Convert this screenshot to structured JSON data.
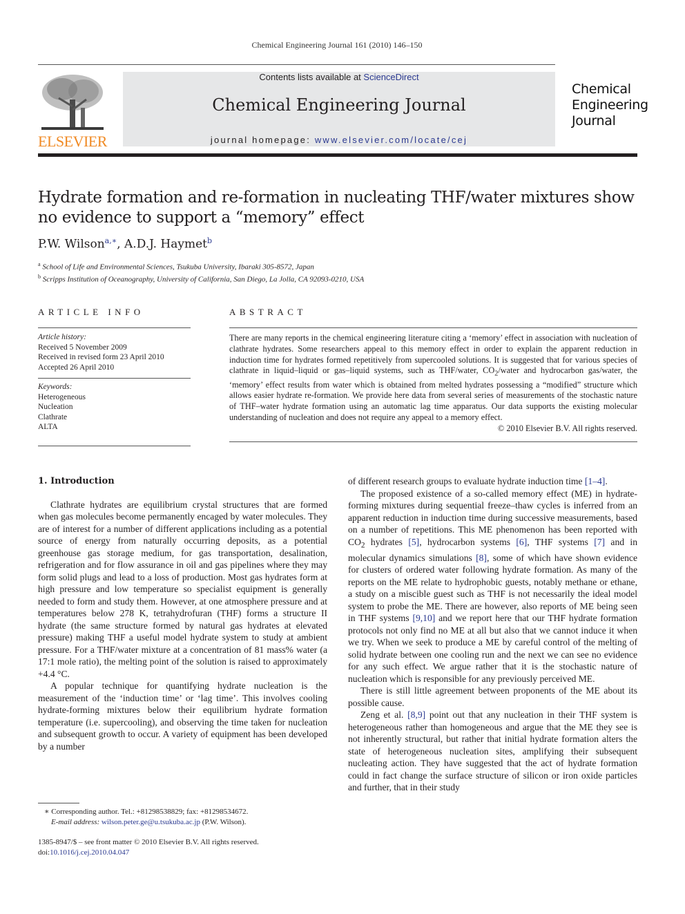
{
  "header": {
    "running_head": "Chemical Engineering Journal 161 (2010) 146–150",
    "contents_prefix": "Contents lists available at ",
    "contents_link": "ScienceDirect",
    "journal_title": "Chemical Engineering Journal",
    "homepage_prefix": "journal homepage: ",
    "homepage_link": "www.elsevier.com/locate/cej",
    "publisher_logo_text": "ELSEVIER",
    "cover_title_lines": [
      "Chemical",
      "Engineering",
      "Journal"
    ],
    "publisher_color": "#f08a24",
    "link_color": "#2b3990"
  },
  "article": {
    "title": "Hydrate formation and re-formation in nucleating THF/water mixtures show no evidence to support a “memory” effect",
    "authors": [
      {
        "name": "P.W. Wilson",
        "marks": "a,∗"
      },
      {
        "name": "A.D.J. Haymet",
        "marks": "b"
      }
    ],
    "author_separator": ", ",
    "affiliations": [
      {
        "mark": "a",
        "text": "School of Life and Environmental Sciences, Tsukuba University, Ibaraki 305-8572, Japan"
      },
      {
        "mark": "b",
        "text": "Scripps Institution of Oceanography, University of California, San Diego, La Jolla, CA 92093-0210, USA"
      }
    ]
  },
  "article_info": {
    "heading": "ARTICLE INFO",
    "history_label": "Article history:",
    "history": [
      "Received 5 November 2009",
      "Received in revised form 23 April 2010",
      "Accepted 26 April 2010"
    ],
    "keywords_label": "Keywords:",
    "keywords": [
      "Heterogeneous",
      "Nucleation",
      "Clathrate",
      "ALTA"
    ]
  },
  "abstract": {
    "heading": "ABSTRACT",
    "text_part1": "There are many reports in the chemical engineering literature citing a ‘memory’ effect in association with nucleation of clathrate hydrates. Some researchers appeal to this memory effect in order to explain the apparent reduction in induction time for hydrates formed repetitively from supercooled solutions. It is suggested that for various species of clathrate in liquid–liquid or gas–liquid systems, such as THF/water, CO",
    "text_sub": "2",
    "text_part2": "/water and hydrocarbon gas/water, the ‘memory’ effect results from water which is obtained from melted hydrates possessing a “modified” structure which allows easier hydrate re-formation. We provide here data from several series of measurements of the stochastic nature of THF–water hydrate formation using an automatic lag time apparatus. Our data supports the existing molecular understanding of nucleation and does not require any appeal to a memory effect.",
    "copyright": "© 2010 Elsevier B.V. All rights reserved."
  },
  "body": {
    "section_heading": "1.  Introduction",
    "left_paragraphs": [
      "Clathrate hydrates are equilibrium crystal structures that are formed when gas molecules become permanently encaged by water molecules. They are of interest for a number of different applications including as a potential source of energy from naturally occurring deposits, as a potential greenhouse gas storage medium, for gas transportation, desalination, refrigeration and for flow assurance in oil and gas pipelines where they may form solid plugs and lead to a loss of production. Most gas hydrates form at high pressure and low temperature so specialist equipment is generally needed to form and study them. However, at one atmosphere pressure and at temperatures below 278 K, tetrahydrofuran (THF) forms a structure II hydrate (the same structure formed by natural gas hydrates at elevated pressure) making THF a useful model hydrate system to study at ambient pressure. For a THF/water mixture at a concentration of 81 mass% water (a 17:1 mole ratio), the melting point of the solution is raised to approximately +4.4 °C.",
      "A popular technique for quantifying hydrate nucleation is the measurement of the ‘induction time’ or ‘lag time’. This involves cooling hydrate-forming mixtures below their equilibrium hydrate formation temperature (i.e. supercooling), and observing the time taken for nucleation and subsequent growth to occur. A variety of equipment has been developed by a number"
    ],
    "right_p1_text": "of different research groups to evaluate hydrate induction time ",
    "right_p1_ref": "[1–4]",
    "right_p1_end": ".",
    "right_p2": {
      "t1": "The proposed existence of a so-called memory effect (ME) in hydrate-forming mixtures during sequential freeze–thaw cycles is inferred from an apparent reduction in induction time during successive measurements, based on a number of repetitions. This ME phenomenon has been reported with CO",
      "sub": "2",
      "t2": " hydrates ",
      "ref1": "[5]",
      "t3": ", hydrocarbon systems ",
      "ref2": "[6]",
      "t4": ", THF systems ",
      "ref3": "[7]",
      "t5": " and in molecular dynamics simulations ",
      "ref4": "[8]",
      "t6": ", some of which have shown evidence for clusters of ordered water following hydrate formation. As many of the reports on the ME relate to hydrophobic guests, notably methane or ethane, a study on a miscible guest such as THF is not necessarily the ideal model system to probe the ME. There are however, also reports of ME being seen in THF systems ",
      "ref5": "[9,10]",
      "t7": " and we report here that our THF hydrate formation protocols not only find no ME at all but also that we cannot induce it when we try. When we seek to produce a ME by careful control of the melting of solid hydrate between one cooling run and the next we can see no evidence for any such effect. We argue rather that it is the stochastic nature of nucleation which is responsible for any previously perceived ME."
    },
    "right_p3": "There is still little agreement between proponents of the ME about its possible cause.",
    "right_p4": {
      "t1": "Zeng et al. ",
      "ref": "[8,9]",
      "t2": " point out that any nucleation in their THF system is heterogeneous rather than homogeneous and argue that the ME they see is not inherently structural, but rather that initial hydrate formation alters the state of heterogeneous nucleation sites, amplifying their subsequent nucleating action. They have suggested that the act of hydrate formation could in fact change the surface structure of silicon or iron oxide particles and further, that in their study"
    }
  },
  "footnotes": {
    "corresponding": "∗  Corresponding author. Tel.: +81298538829; fax: +81298534672.",
    "email_label": "E-mail address: ",
    "email": "wilson.peter.ge@u.tsukuba.ac.jp",
    "email_suffix": " (P.W. Wilson).",
    "front_matter": "1385-8947/$ – see front matter © 2010 Elsevier B.V. All rights reserved.",
    "doi_label": "doi:",
    "doi": "10.1016/j.cej.2010.04.047"
  }
}
